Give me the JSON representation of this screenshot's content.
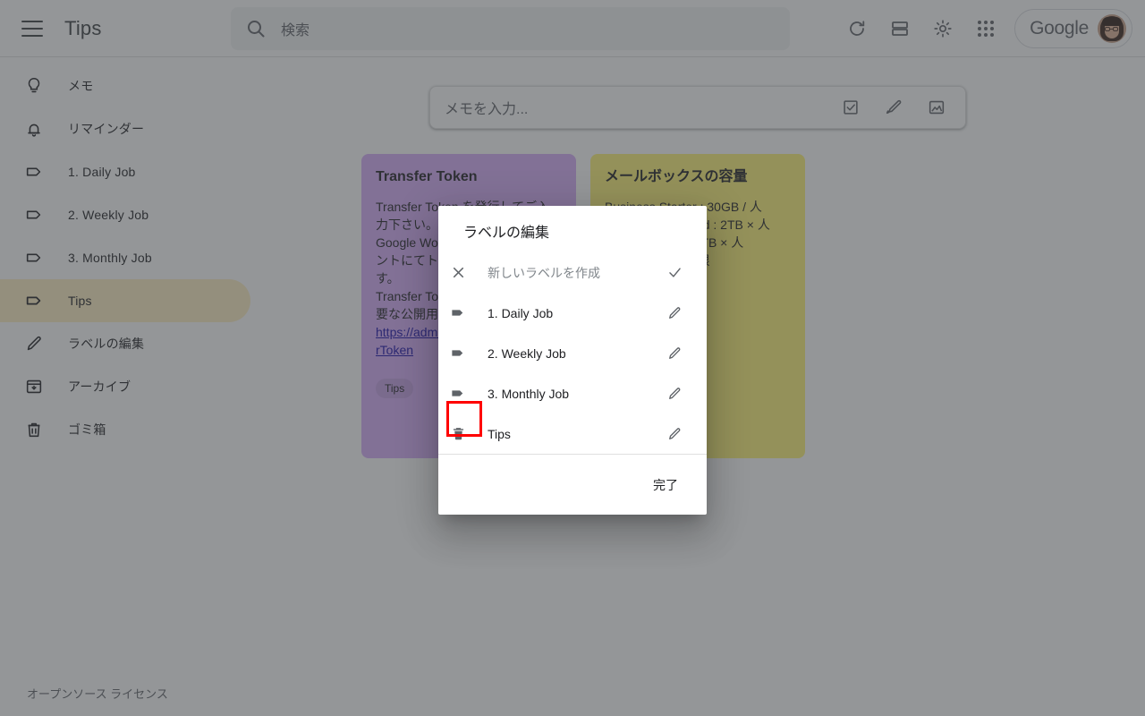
{
  "header": {
    "menu_icon": "hamburger-menu-icon",
    "title": "Tips",
    "search": {
      "icon": "search-icon",
      "placeholder": "検索",
      "value": ""
    },
    "actions": [
      {
        "name": "refresh-button",
        "icon": "refresh-icon"
      },
      {
        "name": "list-view-button",
        "icon": "list-view-icon"
      },
      {
        "name": "settings-button",
        "icon": "gear-icon"
      },
      {
        "name": "google-apps-button",
        "icon": "apps-grid-icon"
      }
    ],
    "account": {
      "label": "Google",
      "avatar": "user-avatar"
    }
  },
  "sidebar": {
    "items": [
      {
        "label": "メモ",
        "icon": "lightbulb-icon",
        "active": false
      },
      {
        "label": "リマインダー",
        "icon": "bell-icon",
        "active": false
      },
      {
        "label": "1. Daily Job",
        "icon": "label-tag-icon",
        "active": false
      },
      {
        "label": "2. Weekly Job",
        "icon": "label-tag-icon",
        "active": false
      },
      {
        "label": "3. Monthly Job",
        "icon": "label-tag-icon",
        "active": false
      },
      {
        "label": "Tips",
        "icon": "label-tag-icon",
        "active": true
      },
      {
        "label": "ラベルの編集",
        "icon": "pencil-icon",
        "active": false
      },
      {
        "label": "アーカイブ",
        "icon": "archive-icon",
        "active": false
      },
      {
        "label": "ゴミ箱",
        "icon": "trash-icon",
        "active": false
      }
    ],
    "footer_link": "オープンソース ライセンス",
    "active_color": "#feefc3"
  },
  "main": {
    "note_input": {
      "placeholder": "メモを入力...",
      "tools": [
        {
          "name": "new-list-button",
          "icon": "checkbox-list-icon"
        },
        {
          "name": "new-drawing-button",
          "icon": "brush-icon"
        },
        {
          "name": "new-image-button",
          "icon": "image-icon"
        }
      ]
    },
    "notes": [
      {
        "title": "Transfer Token",
        "color": "#d7aefb",
        "body": "Transfer Token を発行してご入力下さい。\nGoogle Workspace 管理者アカウントにてトークンを発行できます。\nTransfer Token とは、移行が必要な公開用の識別番号です。",
        "link": "https://admin.google.com/TransferToken",
        "chips": [
          "Tips"
        ]
      },
      {
        "title": "メールボックスの容量",
        "color": "#fff475",
        "body": "Business Starter : 30GB / 人\nBusiness Standard : 2TB × 人\nBusiness Plus : 5TB × 人\nEnterprise : 無制限",
        "chips": []
      }
    ]
  },
  "dialog": {
    "title": "ラベルの編集",
    "new_label": {
      "placeholder": "新しいラベルを作成",
      "value": "",
      "clear_icon": "close-icon",
      "confirm_icon": "check-icon"
    },
    "labels": [
      {
        "name": "1. Daily Job",
        "lead_icon": "label-tag-icon",
        "trail_icon": "pencil-icon",
        "hovered": false
      },
      {
        "name": "2. Weekly Job",
        "lead_icon": "label-tag-icon",
        "trail_icon": "pencil-icon",
        "hovered": false
      },
      {
        "name": "3. Monthly Job",
        "lead_icon": "label-tag-icon",
        "trail_icon": "pencil-icon",
        "hovered": false
      },
      {
        "name": "Tips",
        "lead_icon": "trash-icon",
        "trail_icon": "pencil-icon",
        "hovered": true
      }
    ],
    "done_label": "完了"
  },
  "annotation": {
    "color": "#ff0000",
    "target": "delete-label-tips-button"
  }
}
